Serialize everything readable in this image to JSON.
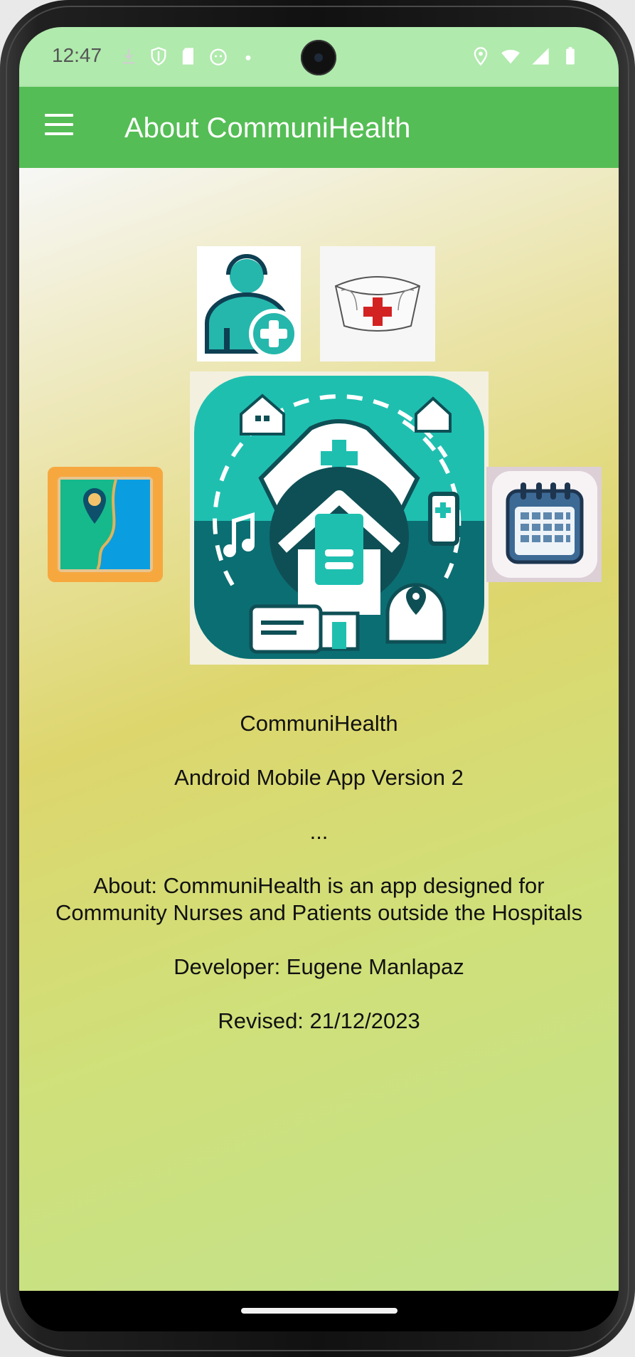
{
  "status_bar": {
    "time": "12:47"
  },
  "app_bar": {
    "title": "About CommuniHealth",
    "menu_icon": "hamburger-menu-icon"
  },
  "images": {
    "nurse_plus": "nurse-with-plus-icon",
    "nurse_cap": "nurse-cap-icon",
    "map": "map-location-icon",
    "app_logo": "communihealth-logo",
    "calendar": "calendar-icon"
  },
  "about": {
    "app_name": "CommuniHealth",
    "version": "Android Mobile App Version 2",
    "ellipsis": "...",
    "description": "About: CommuniHealth is an app designed for Community Nurses and Patients outside the Hospitals",
    "developer": "Developer: Eugene Manlapaz",
    "revised": "Revised: 21/12/2023"
  },
  "colors": {
    "status_bar": "#b0eaad",
    "app_bar": "#55bd55",
    "logo_teal": "#1fbfb0",
    "logo_dark": "#0e4f55"
  }
}
